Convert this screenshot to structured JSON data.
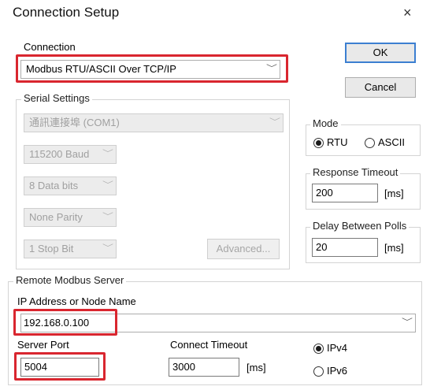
{
  "window": {
    "title": "Connection Setup",
    "close": "×"
  },
  "connection": {
    "label": "Connection",
    "selected": "Modbus RTU/ASCII Over TCP/IP",
    "highlight_color": "#d9262f"
  },
  "serial": {
    "label": "Serial Settings",
    "port": "通訊連接埠 (COM1)",
    "baud": "115200 Baud",
    "data_bits": "8 Data bits",
    "parity": "None Parity",
    "stop_bits": "1 Stop Bit",
    "advanced": "Advanced..."
  },
  "buttons": {
    "ok": "OK",
    "cancel": "Cancel"
  },
  "mode": {
    "label": "Mode",
    "rtu": "RTU",
    "ascii": "ASCII",
    "selected": "RTU"
  },
  "response_timeout": {
    "label": "Response Timeout",
    "value": "200",
    "unit": "[ms]"
  },
  "delay_polls": {
    "label": "Delay Between Polls",
    "value": "20",
    "unit": "[ms]"
  },
  "remote": {
    "label": "Remote Modbus Server",
    "ip_label": "IP Address or Node Name",
    "ip_value": "192.168.0.100",
    "port_label": "Server Port",
    "port_value": "5004",
    "timeout_label": "Connect Timeout",
    "timeout_value": "3000",
    "timeout_unit": "[ms]",
    "ipv4": "IPv4",
    "ipv6": "IPv6",
    "ip_version": "IPv4"
  }
}
